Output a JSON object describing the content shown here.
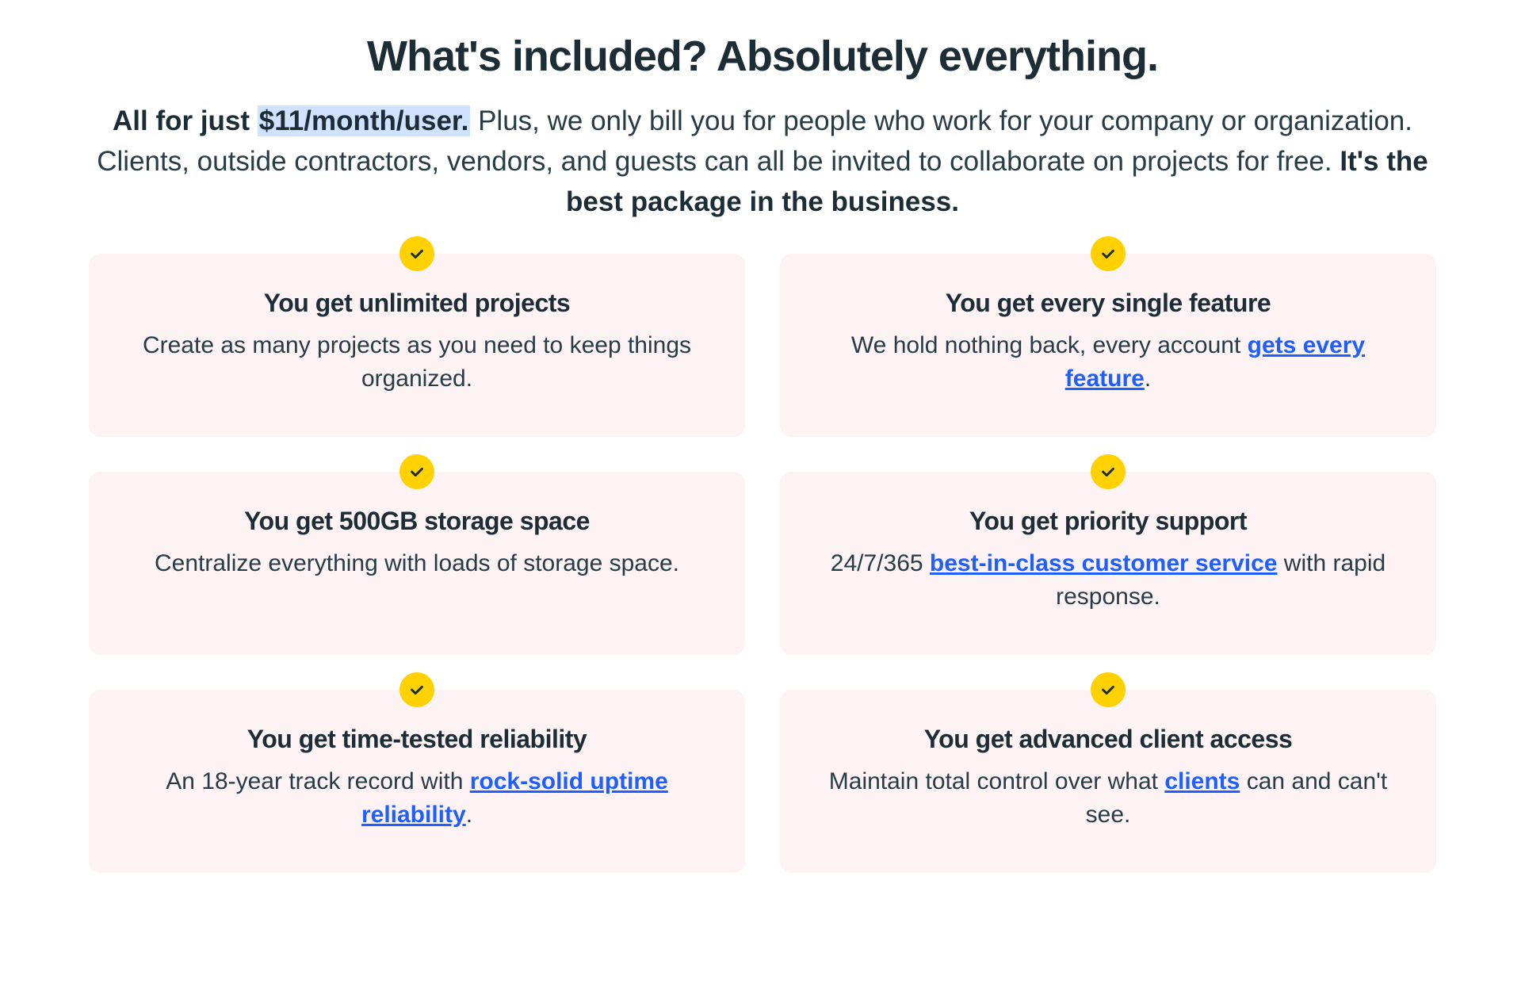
{
  "heading": "What's included? Absolutely everything.",
  "intro": {
    "lead_prefix": "All for just ",
    "price": "$11/month/user.",
    "body": " Plus, we only bill you for people who work for your company or organization. Clients, outside contractors, vendors, and guests can all be invited to collaborate on projects for free. ",
    "tail": "It's the best package in the business."
  },
  "cards": [
    {
      "title": "You get unlimited projects",
      "pre": "Create as many projects as you need to keep things organized.",
      "link": "",
      "post": ""
    },
    {
      "title": "You get every single feature",
      "pre": "We hold nothing back, every account ",
      "link": "gets every feature",
      "post": "."
    },
    {
      "title": "You get 500GB storage space",
      "pre": "Centralize everything with loads of storage space.",
      "link": "",
      "post": ""
    },
    {
      "title": "You get priority support",
      "pre": "24/7/365 ",
      "link": "best-in-class customer service",
      "post": " with rapid response."
    },
    {
      "title": "You get time-tested reliability",
      "pre": "An 18-year track record with ",
      "link": "rock-solid uptime reliability",
      "post": "."
    },
    {
      "title": "You get advanced client access",
      "pre": "Maintain total control over what ",
      "link": "clients",
      "post": " can and can't see."
    }
  ]
}
